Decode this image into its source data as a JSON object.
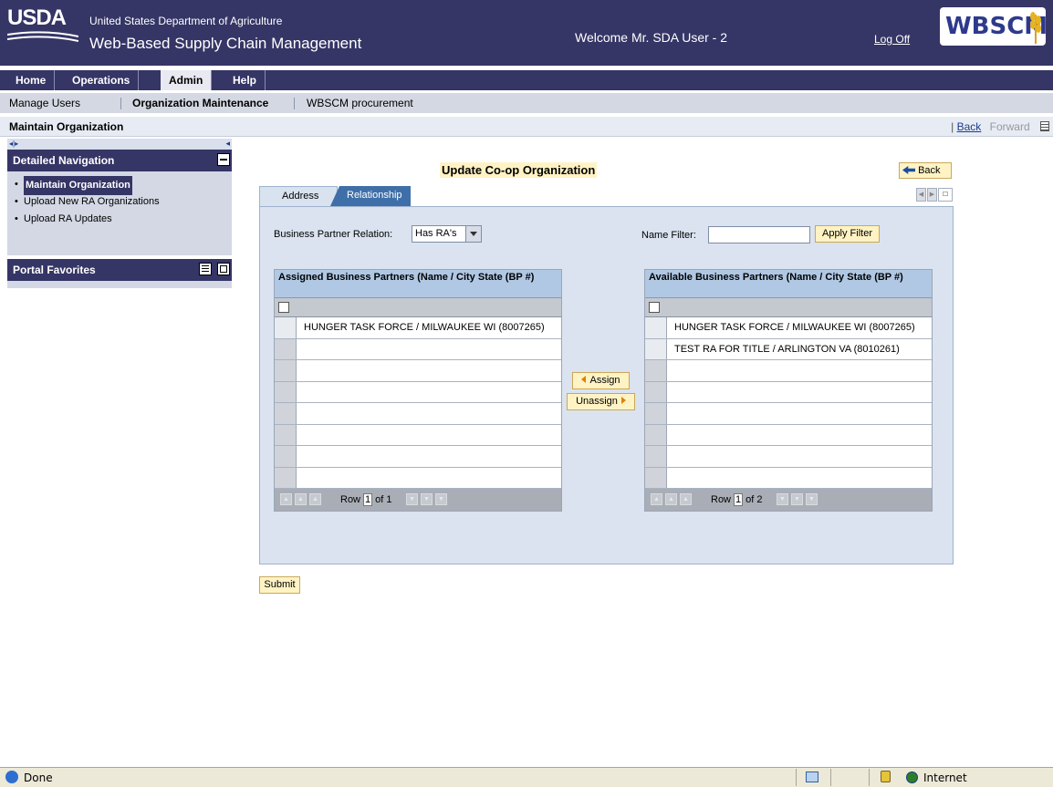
{
  "header": {
    "logo_text": "USDA",
    "department": "United States Department of Agriculture",
    "app_title": "Web-Based Supply Chain Management",
    "welcome": "Welcome Mr. SDA User - 2",
    "logoff": "Log Off",
    "brand_logo": "WBSCM"
  },
  "topnav": {
    "tabs": [
      {
        "label": "Home"
      },
      {
        "label": "Operations"
      },
      {
        "label": "Admin"
      },
      {
        "label": "Help"
      }
    ]
  },
  "subnav": {
    "items": [
      {
        "label": "Manage Users"
      },
      {
        "label": "Organization Maintenance"
      },
      {
        "label": "WBSCM procurement"
      }
    ]
  },
  "pagebar": {
    "title": "Maintain Organization",
    "separator": "|",
    "back": "Back",
    "forward": "Forward"
  },
  "leftnav": {
    "detailed_header": "Detailed Navigation",
    "items": [
      {
        "label": "Maintain Organization"
      },
      {
        "label": "Upload New RA Organizations"
      },
      {
        "label": "Upload RA Updates"
      }
    ],
    "favorites_header": "Portal Favorites"
  },
  "main": {
    "title": "Update Co-op Organization",
    "back_button": "Back",
    "tabs": [
      {
        "label": "Address"
      },
      {
        "label": "Relationship"
      }
    ],
    "bp_relation_label": "Business Partner Relation:",
    "bp_relation_value": "Has RA's",
    "name_filter_label": "Name Filter:",
    "name_filter_value": "",
    "apply_filter": "Apply Filter",
    "assign": "Assign",
    "unassign": "Unassign",
    "submit": "Submit"
  },
  "assigned_table": {
    "title": "Assigned Business Partners (Name / City State (BP #)",
    "rows": [
      "HUNGER TASK FORCE / MILWAUKEE WI (8007265)",
      "",
      "",
      "",
      "",
      "",
      "",
      ""
    ],
    "row_label": "Row",
    "row_current": "1",
    "row_total": "of 1"
  },
  "available_table": {
    "title": "Available Business Partners (Name / City State (BP #)",
    "rows": [
      "HUNGER TASK FORCE / MILWAUKEE WI (8007265)",
      "TEST RA FOR TITLE / ARLINGTON VA (8010261)",
      "",
      "",
      "",
      "",
      "",
      ""
    ],
    "row_label": "Row",
    "row_current": "1",
    "row_total": "of 2"
  },
  "statusbar": {
    "status": "Done",
    "zone": "Internet"
  },
  "colors": {
    "header_bg": "#353566",
    "highlight_bg": "#fff3c4",
    "table_title_bg": "#b0c8e4",
    "content_bg": "#dae3ef",
    "active_tab_bg": "#3f6fa8"
  }
}
